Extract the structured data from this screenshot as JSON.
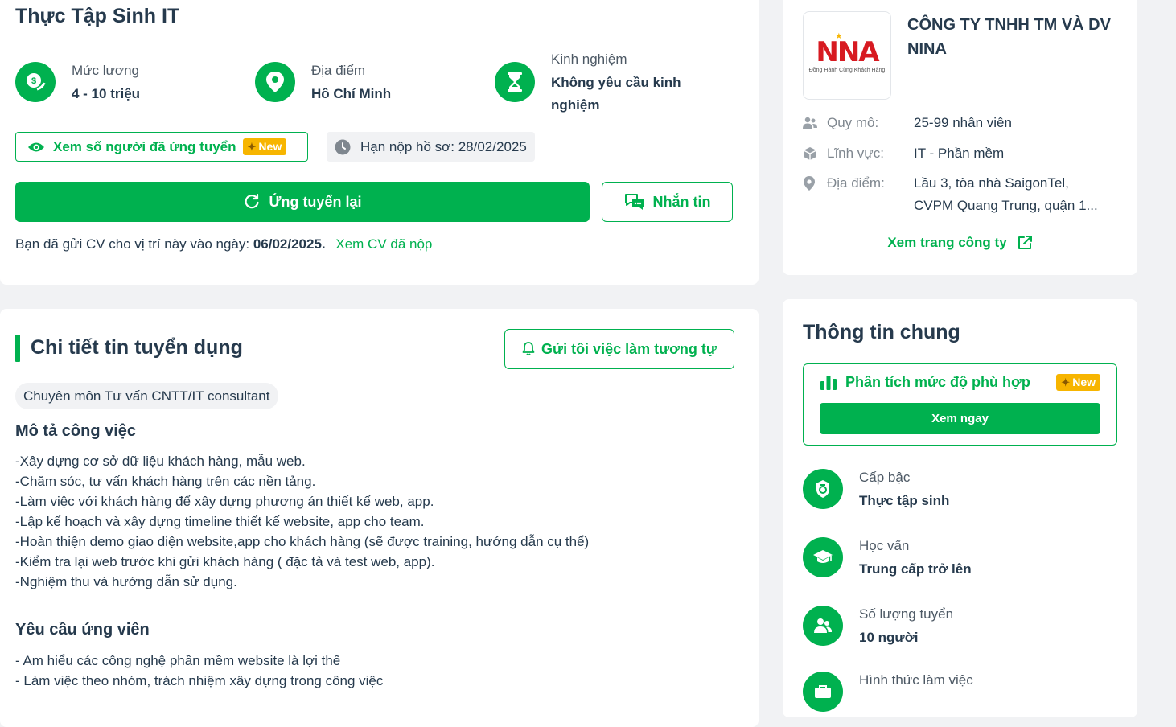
{
  "job": {
    "title": "Thực Tập Sinh IT",
    "salary": {
      "label": "Mức lương",
      "value": "4 - 10 triệu",
      "icon": "money-icon"
    },
    "location": {
      "label": "Địa điểm",
      "value": "Hồ Chí Minh",
      "icon": "location-pin-icon"
    },
    "experience": {
      "label": "Kinh nghiệm",
      "value_line1": "Không yêu cầu kinh",
      "value_line2": "nghiệm",
      "icon": "hourglass-icon"
    },
    "view_applicants": "Xem số người đã ứng tuyển",
    "new_badge": "New",
    "deadline": "Hạn nộp hồ sơ: 28/02/2025",
    "reapply_button": "Ứng tuyển lại",
    "message_button": "Nhắn tin",
    "sent_note_prefix": "Bạn đã gửi CV cho vị trí này vào ngày:",
    "sent_date": "06/02/2025.",
    "view_cv_link": "Xem CV đã nộp"
  },
  "detail": {
    "title": "Chi tiết tin tuyển dụng",
    "notify_button": "Gửi tôi việc làm tương tự",
    "specialty_tag": "Chuyên môn Tư vấn CNTT/IT consultant",
    "description_title": "Mô tả công việc",
    "description": [
      "-Xây dựng cơ sở dữ liệu khách hàng, mẫu web.",
      "-Chăm sóc, tư vấn khách hàng trên các nền tảng.",
      "-Làm việc với khách hàng để xây dựng phương án thiết kế web, app.",
      "-Lập kế hoạch và xây dựng timeline thiết kế website, app cho team.",
      "-Hoàn thiện demo giao diện website,app cho khách hàng (sẽ được training, hướng dẫn cụ thể)",
      "-Kiểm tra lại web trước khi gửi khách hàng ( đặc tả và test web, app).",
      "-Nghiệm thu và hướng dẫn sử dụng."
    ],
    "requirements_title": "Yêu cầu ứng viên",
    "requirements": [
      "- Am hiểu các công nghệ phần mềm website là lợi thế",
      "- Làm việc theo nhóm, trách nhiệm xây dựng trong công việc"
    ]
  },
  "company": {
    "logo_text": "NNA",
    "logo_tagline": "Đồng Hành Cùng Khách Hàng",
    "name": "CÔNG TY TNHH TM VÀ DV NINA",
    "size_label": "Quy mô:",
    "size_value": "25-99 nhân viên",
    "field_label": "Lĩnh vực:",
    "field_value": "IT - Phần mềm",
    "address_label": "Địa điểm:",
    "address_line1": "Lầu 3, tòa nhà SaigonTel,",
    "address_line2": "CVPM Quang Trung, quận 1...",
    "page_link": "Xem trang công ty"
  },
  "general": {
    "title": "Thông tin chung",
    "fit_label": "Phân tích mức độ phù hợp",
    "fit_badge": "New",
    "fit_button": "Xem ngay",
    "level_label": "Cấp bậc",
    "level_value": "Thực tập sinh",
    "education_label": "Học vấn",
    "education_value": "Trung cấp trở lên",
    "quantity_label": "Số lượng tuyển",
    "quantity_value": "10 người",
    "worktype_label": "Hình thức làm việc"
  },
  "colors": {
    "accent": "#00b14f",
    "badge": "#f7b500",
    "text": "#263a4d"
  }
}
